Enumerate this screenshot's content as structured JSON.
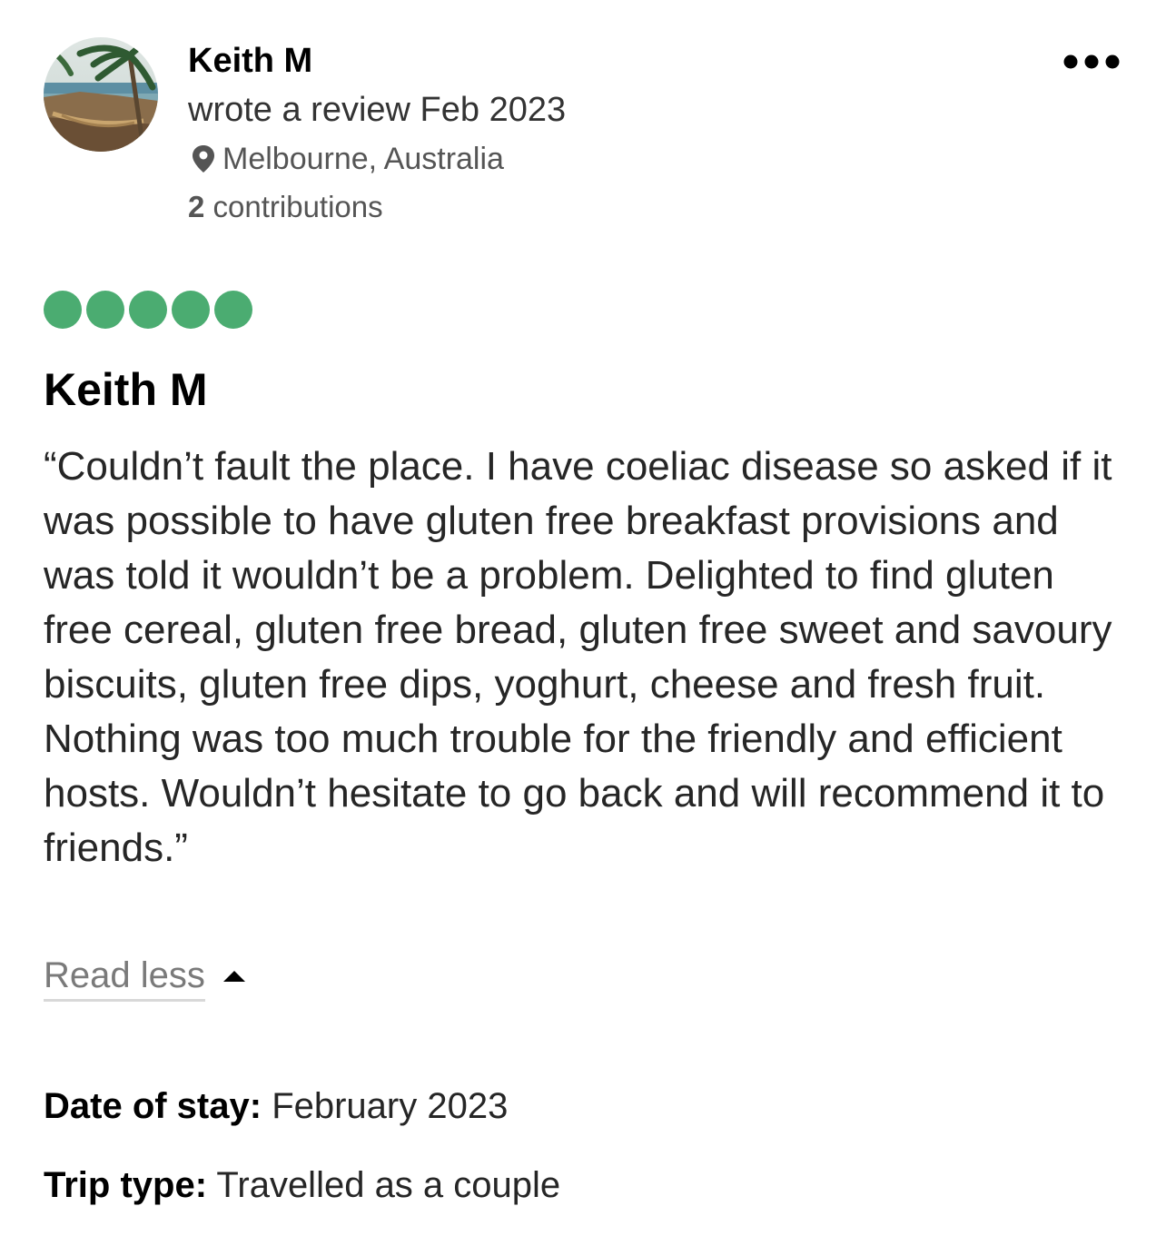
{
  "review": {
    "author": {
      "name": "Keith M",
      "meta": "wrote a review Feb 2023",
      "location": "Melbourne, Australia",
      "contributions_count": "2",
      "contributions_label": "contributions",
      "avatar_icon": "avatar-beach-hammock"
    },
    "more_icon": "more-horizontal-icon",
    "rating": {
      "value": 5,
      "max": 5,
      "color": "#4bac71"
    },
    "title": "Keith M",
    "body": "“Couldn’t fault the place. I have coeliac disease so asked if it was possible to have gluten free breakfast provisions and was told it wouldn’t be a problem. Delighted to find gluten free cereal, gluten free bread, gluten free sweet and savoury biscuits, gluten free dips, yoghurt, cheese and fresh fruit. Nothing was too much trouble for the friendly and efficient hosts. Wouldn’t hesitate to go back and will recommend it to friends.”",
    "read_less_label": "Read less",
    "details": {
      "date_label": "Date of stay:",
      "date_value": "February 2023",
      "trip_label": "Trip type:",
      "trip_value": "Travelled as a couple"
    }
  }
}
